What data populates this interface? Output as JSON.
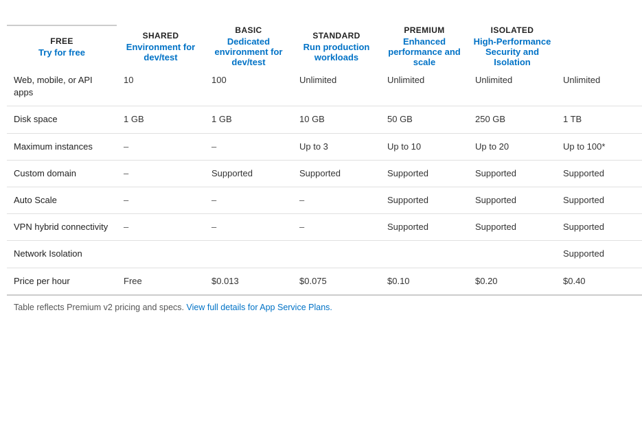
{
  "tiers": [
    {
      "id": "free",
      "label": "FREE",
      "description": "Try for free"
    },
    {
      "id": "shared",
      "label": "SHARED",
      "description": "Environment for dev/test"
    },
    {
      "id": "basic",
      "label": "BASIC",
      "description": "Dedicated environment for dev/test"
    },
    {
      "id": "standard",
      "label": "STANDARD",
      "description": "Run production workloads"
    },
    {
      "id": "premium",
      "label": "PREMIUM",
      "description": "Enhanced performance and scale"
    },
    {
      "id": "isolated",
      "label": "ISOLATED",
      "description": "High-Performance Security and Isolation"
    }
  ],
  "rows": [
    {
      "feature": "Web, mobile, or API apps",
      "values": [
        "10",
        "100",
        "Unlimited",
        "Unlimited",
        "Unlimited",
        "Unlimited"
      ]
    },
    {
      "feature": "Disk space",
      "values": [
        "1 GB",
        "1 GB",
        "10 GB",
        "50 GB",
        "250 GB",
        "1 TB"
      ]
    },
    {
      "feature": "Maximum instances",
      "values": [
        "–",
        "–",
        "Up to 3",
        "Up to 10",
        "Up to 20",
        "Up to 100*"
      ]
    },
    {
      "feature": "Custom domain",
      "values": [
        "–",
        "Supported",
        "Supported",
        "Supported",
        "Supported",
        "Supported"
      ]
    },
    {
      "feature": "Auto Scale",
      "values": [
        "–",
        "–",
        "–",
        "Supported",
        "Supported",
        "Supported"
      ]
    },
    {
      "feature": "VPN hybrid connectivity",
      "values": [
        "–",
        "–",
        "–",
        "Supported",
        "Supported",
        "Supported"
      ]
    },
    {
      "feature": "Network Isolation",
      "values": [
        "",
        "",
        "",
        "",
        "",
        "Supported"
      ]
    },
    {
      "feature": "Price per hour",
      "values": [
        "Free",
        "$0.013",
        "$0.075",
        "$0.10",
        "$0.20",
        "$0.40"
      ]
    }
  ],
  "footer": {
    "static_text": "Table reflects Premium v2 pricing and specs. ",
    "link_text": "View full details for App Service Plans.",
    "link_href": "#"
  }
}
